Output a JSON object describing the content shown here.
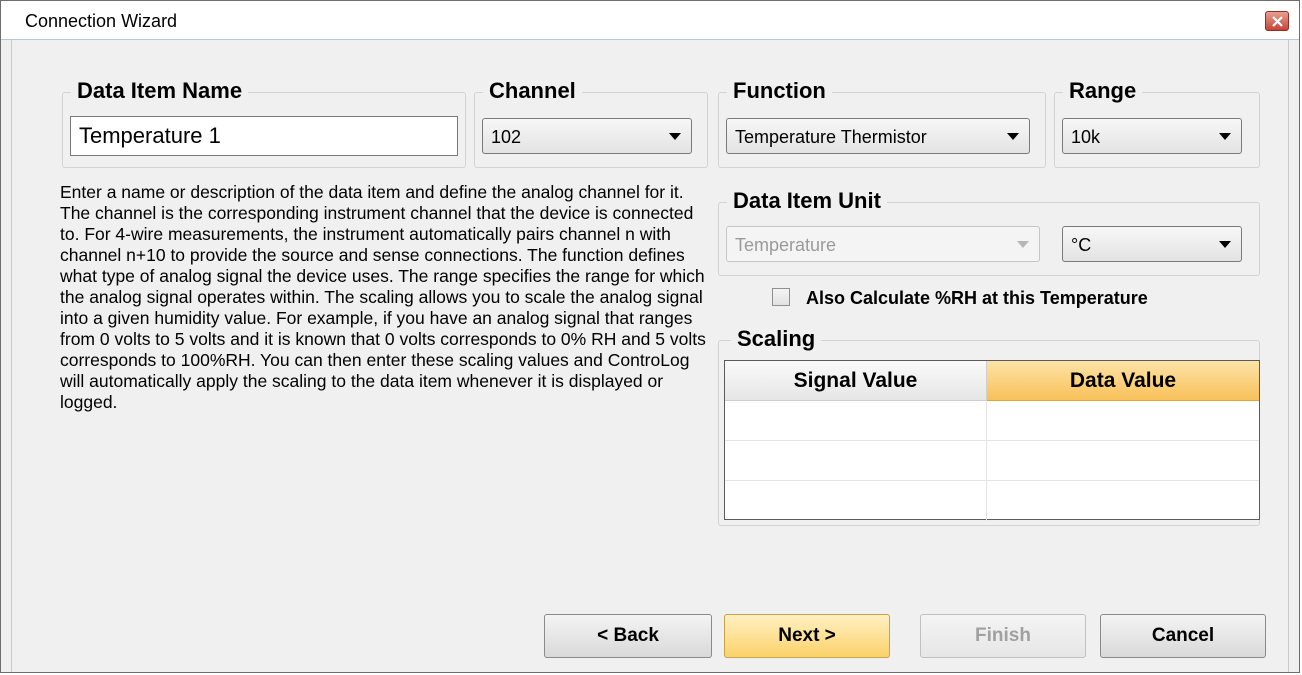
{
  "window": {
    "title": "Connection Wizard"
  },
  "data_item_name": {
    "label": "Data Item Name",
    "value": "Temperature 1"
  },
  "channel": {
    "label": "Channel",
    "value": "102"
  },
  "function": {
    "label": "Function",
    "value": "Temperature Thermistor"
  },
  "range": {
    "label": "Range",
    "value": "10k"
  },
  "description": "Enter a name or description of the data item and define the analog channel for it.  The channel is the corresponding instrument channel that the device is connected to.  For 4-wire measurements, the instrument automatically pairs channel n with channel n+10 to provide the source and sense connections.  The function defines what type of analog signal the device uses.  The range specifies the range for which the analog signal operates within.  The scaling allows you to scale the analog signal into a given humidity value.  For example, if you have an analog signal that ranges from 0 volts to 5 volts and it is known that 0 volts corresponds to 0% RH and 5 volts corresponds to 100%RH.  You can then enter these scaling values and ControLog will automatically apply the scaling to the data item whenever it is displayed or logged.",
  "data_item_unit": {
    "label": "Data Item Unit",
    "quantity": "Temperature",
    "unit": "°C"
  },
  "rh_checkbox": {
    "label": "Also Calculate %RH at this Temperature",
    "checked": false
  },
  "scaling": {
    "label": "Scaling",
    "columns": [
      "Signal Value",
      "Data Value"
    ],
    "rows": [
      [
        "",
        ""
      ],
      [
        "",
        ""
      ],
      [
        "",
        ""
      ]
    ]
  },
  "buttons": {
    "back": "< Back",
    "next": "Next >",
    "finish": "Finish",
    "cancel": "Cancel"
  }
}
